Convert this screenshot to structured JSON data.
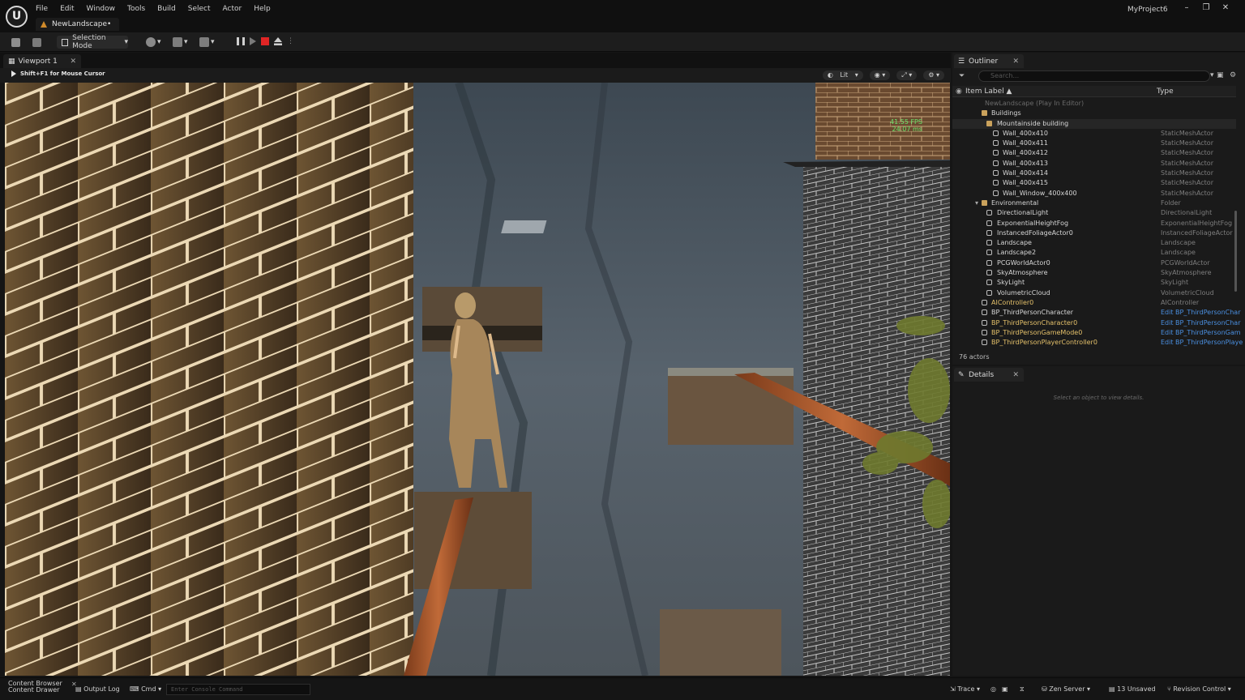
{
  "app": {
    "menu": [
      "File",
      "Edit",
      "Window",
      "Tools",
      "Build",
      "Select",
      "Actor",
      "Help"
    ],
    "document_tab": "NewLandscape•",
    "project": "MyProject6",
    "window_controls": [
      "–",
      "❐",
      "✕"
    ]
  },
  "toolbar": {
    "mode_label": "Selection Mode"
  },
  "viewport": {
    "tab_label": "Viewport 1",
    "hint": "Shift+F1 for Mouse Cursor",
    "view_mode": "Lit",
    "fps_text": "41.55 FPS",
    "fps_ms": "24.07 ms"
  },
  "outliner": {
    "tab_label": "Outliner",
    "search_placeholder": "Search...",
    "col_label": "Item Label ▲",
    "col_type": "Type",
    "rows": [
      {
        "label": "NewLandscape (Play In Editor)",
        "type": "",
        "dim": true
      },
      {
        "label": "Buildings",
        "type": ""
      },
      {
        "label": "Mountainside building",
        "type": "",
        "sel": true
      },
      {
        "label": "Wall_400x410",
        "type": "StaticMeshActor"
      },
      {
        "label": "Wall_400x411",
        "type": "StaticMeshActor"
      },
      {
        "label": "Wall_400x412",
        "type": "StaticMeshActor"
      },
      {
        "label": "Wall_400x413",
        "type": "StaticMeshActor"
      },
      {
        "label": "Wall_400x414",
        "type": "StaticMeshActor"
      },
      {
        "label": "Wall_400x415",
        "type": "StaticMeshActor"
      },
      {
        "label": "Wall_Window_400x400",
        "type": "StaticMeshActor"
      },
      {
        "label": "Environmental",
        "type": "Folder"
      },
      {
        "label": "DirectionalLight",
        "type": "DirectionalLight"
      },
      {
        "label": "ExponentialHeightFog",
        "type": "ExponentialHeightFog"
      },
      {
        "label": "InstancedFoliageActor0",
        "type": "InstancedFoliageActor"
      },
      {
        "label": "Landscape",
        "type": "Landscape"
      },
      {
        "label": "Landscape2",
        "type": "Landscape"
      },
      {
        "label": "PCGWorldActor0",
        "type": "PCGWorldActor"
      },
      {
        "label": "SkyAtmosphere",
        "type": "SkyAtmosphere"
      },
      {
        "label": "SkyLight",
        "type": "SkyLight"
      },
      {
        "label": "VolumetricCloud",
        "type": "VolumetricCloud"
      },
      {
        "label": "AIController0",
        "type": "AIController",
        "gold": true
      },
      {
        "label": "BP_ThirdPersonCharacter",
        "type": "Edit BP_ThirdPersonChar",
        "link": true
      },
      {
        "label": "BP_ThirdPersonCharacter0",
        "type": "Edit BP_ThirdPersonChar",
        "link": true,
        "gold": true
      },
      {
        "label": "BP_ThirdPersonGameMode0",
        "type": "Edit BP_ThirdPersonGam",
        "link": true,
        "gold": true
      },
      {
        "label": "BP_ThirdPersonPlayerController0",
        "type": "Edit BP_ThirdPersonPlaye",
        "link": true,
        "gold": true
      }
    ],
    "count": "76 actors"
  },
  "details": {
    "tab_label": "Details",
    "empty_text": "Select an object to view details."
  },
  "statusbar": {
    "content_browser": "Content Browser",
    "content_drawer": "Content Drawer",
    "output_log": "Output Log",
    "cmd": "Cmd",
    "console_placeholder": "Enter Console Command",
    "trace": "Trace",
    "zen": "Zen Server",
    "unsaved": "13 Unsaved",
    "revision": "Revision Control"
  }
}
